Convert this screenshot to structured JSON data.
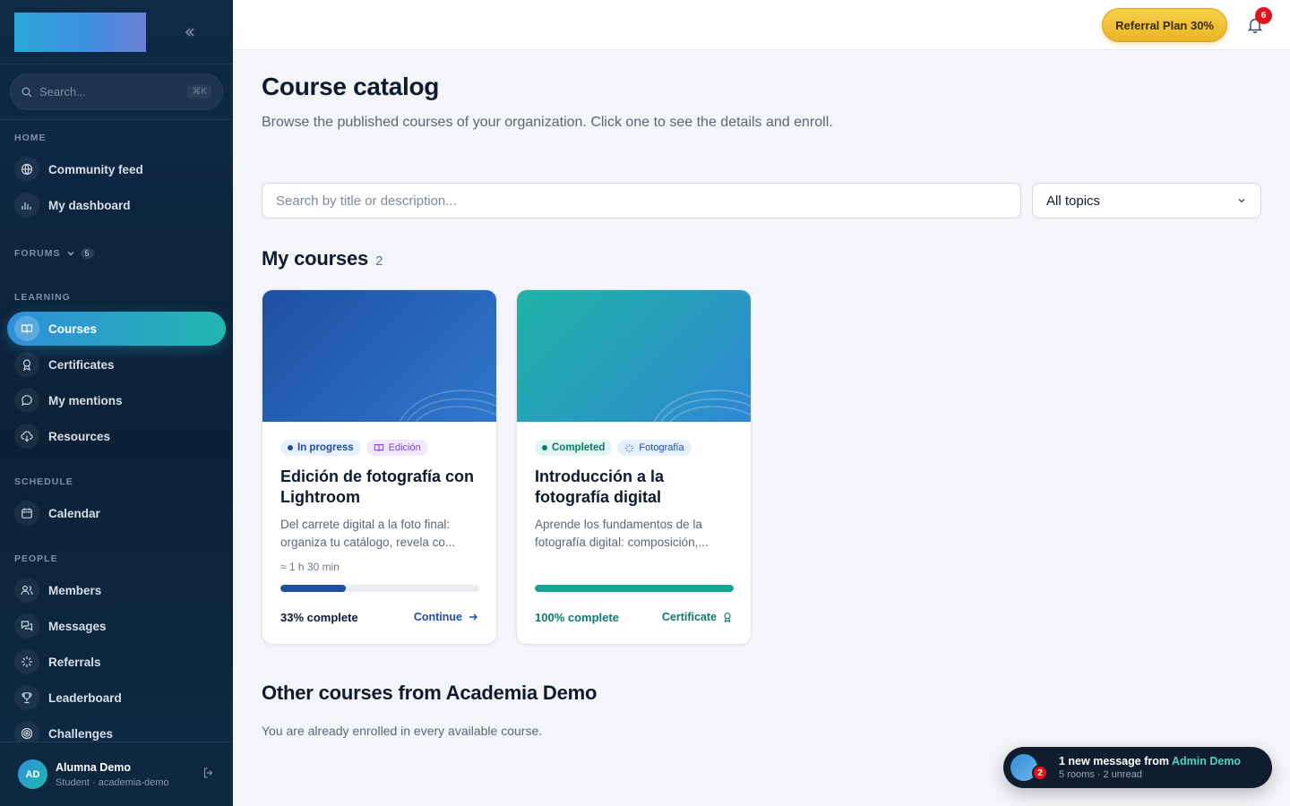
{
  "sidebar": {
    "search_placeholder": "Search...",
    "search_shortcut": "⌘K",
    "sections": {
      "home": "HOME",
      "forums": "FORUMS",
      "forums_count": "5",
      "learning": "LEARNING",
      "schedule": "SCHEDULE",
      "people": "PEOPLE"
    },
    "items": {
      "community_feed": "Community feed",
      "my_dashboard": "My dashboard",
      "courses": "Courses",
      "certificates": "Certificates",
      "my_mentions": "My mentions",
      "resources": "Resources",
      "calendar": "Calendar",
      "members": "Members",
      "messages": "Messages",
      "referrals": "Referrals",
      "leaderboard": "Leaderboard",
      "challenges": "Challenges"
    },
    "user": {
      "initials": "AD",
      "name": "Alumna Demo",
      "role": "Student · academia-demo"
    }
  },
  "topbar": {
    "referral_label": "Referral Plan 30%",
    "notification_count": "6"
  },
  "main": {
    "title": "Course catalog",
    "subtitle": "Browse the published courses of your organization. Click one to see the details and enroll.",
    "filter_placeholder": "Search by title or description...",
    "topic_select": "All topics",
    "my_courses_heading": "My courses",
    "my_courses_count": "2",
    "other_heading": "Other courses from Academia Demo",
    "other_empty": "You are already enrolled in every available course."
  },
  "courses": [
    {
      "status": "In progress",
      "topic": "Edición",
      "title": "Edición de fotografía con Lightroom",
      "desc_line1": "Del carrete digital a la foto final:",
      "desc_line2": "organiza tu catálogo, revela co...",
      "duration": "≈ 1 h 30 min",
      "progress": 0.33,
      "progress_label": "33% complete",
      "action": "Continue"
    },
    {
      "status": "Completed",
      "topic": "Fotografía",
      "title": "Introducción a la fotografía digital",
      "desc_line1": "Aprende los fundamentos de la",
      "desc_line2": "fotografía digital: composición,...",
      "progress": 1.0,
      "progress_label": "100% complete",
      "action": "Certificate"
    }
  ],
  "toast": {
    "unread_badge": "2",
    "prefix": "1 new message from",
    "sender": "Admin Demo",
    "detail": "5 rooms · 2 unread"
  },
  "colors": {
    "accent_blue": "#1e4fa3",
    "accent_teal": "#14a394",
    "referral_gold": "#f2c233",
    "badge_red": "#e0141d"
  }
}
